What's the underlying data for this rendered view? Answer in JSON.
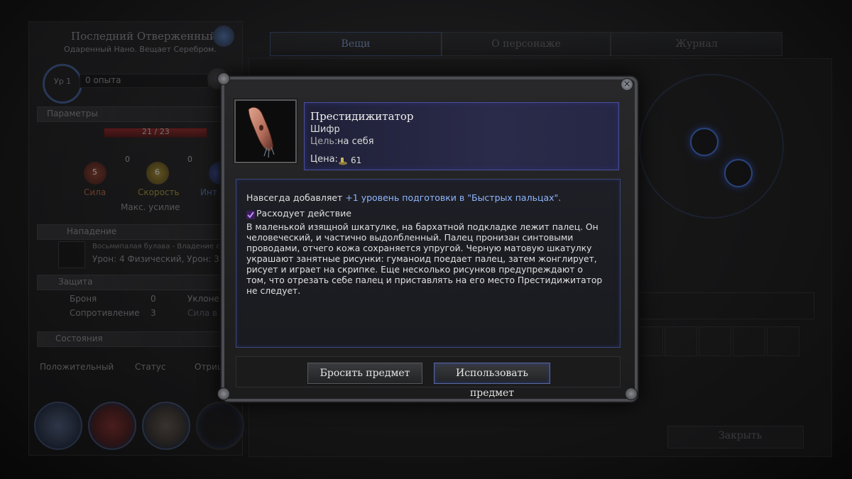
{
  "background": {
    "char_name": "Последний Отверженный",
    "char_sub": "Одаренный Нано. Вещает Серебром.",
    "level": "Ур 1",
    "xp": "0 опыта",
    "params_header": "Параметры",
    "hp": "21 / 23",
    "stats": [
      {
        "label": "Сила",
        "value": "5",
        "points": "0"
      },
      {
        "label": "Скорость",
        "value": "6",
        "points": "0"
      },
      {
        "label": "Инт",
        "value": "",
        "points": ""
      }
    ],
    "max_effort": "Макс. усилие",
    "attack_header": "Нападение",
    "weapon_line": "Восьмипалая булава - Владение сред",
    "damage_line": "Урон: 4 Физический, Урон: 3",
    "defense_header": "Защита",
    "armor_label": "Броня",
    "armor_value": "0",
    "resist_label": "Сопротивление",
    "resist_value": "3",
    "dodge_label": "Уклоне",
    "will_label": "Сила в",
    "states_header": "Состояния",
    "state_labels": [
      "Положительный",
      "Статус",
      "Отриц"
    ],
    "tabs": [
      "Вещи",
      "О персонаже",
      "Журнал"
    ],
    "close_label": "Закрыть"
  },
  "modal": {
    "item_name": "Престидижитатор",
    "item_type": "Шифр",
    "target_label": "Цель:",
    "target_value": "на себя",
    "price_label": "Цена:",
    "price_value": "61",
    "bonus_prefix": "Навсегда добавляет",
    "bonus_highlight": "+1 уровень подготовки в \"Быстрых пальцах\".",
    "consumes": "Расходует действие",
    "description": "В маленькой изящной шкатулке, на бархатной подкладке лежит палец. Он человеческий, и частично выдолбленный. Палец пронизан синтовыми проводами, отчего кожа сохраняется упругой. Черную матовую шкатулку украшают занятные рисунки: гуманоид поедает палец, затем жонглирует, рисует и играет на скрипке. Еще несколько рисунков предупреждают о том, что отрезать себе палец и приставлять на его место Престидижитатор не следует.",
    "drop_button": "Бросить предмет",
    "use_button": "Использовать предмет",
    "close_icon": "×"
  },
  "colors": {
    "accent_blue": "#8fb6ff",
    "header_border": "#4b4f9a",
    "panel_bg": "#1e1f26"
  }
}
